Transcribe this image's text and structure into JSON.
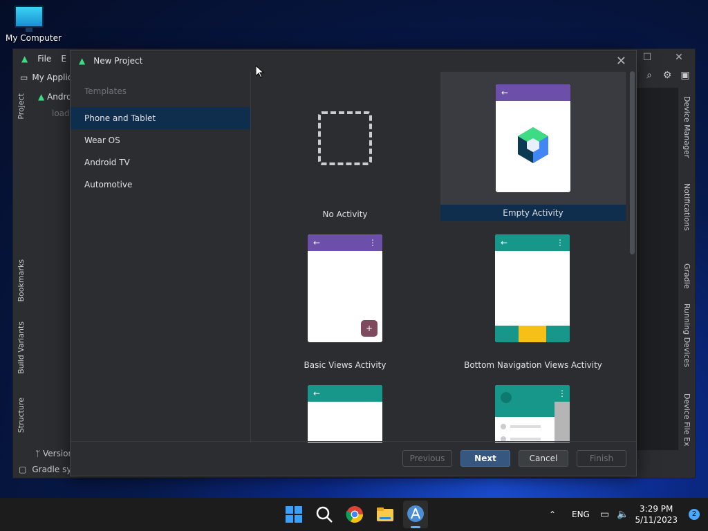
{
  "desktop": {
    "icon_label": "My Computer"
  },
  "ide": {
    "menu": [
      "File",
      "E"
    ],
    "project_name": "My Applica",
    "tree_item": "Andro",
    "tree_sub": "load",
    "left_tabs": [
      "Project",
      "Bookmarks",
      "Build Variants",
      "Structure"
    ],
    "right_tabs": [
      "Device Manager",
      "Notifications",
      "Gradle",
      "Running Devices",
      "Device File Ex"
    ],
    "version_label": "Version",
    "status_text": "Gradle sync"
  },
  "dialog": {
    "title": "New Project",
    "sidebar_header": "Templates",
    "categories": [
      "Phone and Tablet",
      "Wear OS",
      "Android TV",
      "Automotive"
    ],
    "templates": [
      "No Activity",
      "Empty Activity",
      "Basic Views Activity",
      "Bottom Navigation Views Activity"
    ],
    "buttons": {
      "previous": "Previous",
      "next": "Next",
      "cancel": "Cancel",
      "finish": "Finish"
    }
  },
  "taskbar": {
    "language": "ENG",
    "time": "3:29 PM",
    "date": "5/11/2023",
    "notification_count": "2"
  },
  "colors": {
    "accent": "#365880",
    "selected_row": "#0f2e4d",
    "purple_bar": "#6b4fa8",
    "teal_bar": "#17978a"
  }
}
